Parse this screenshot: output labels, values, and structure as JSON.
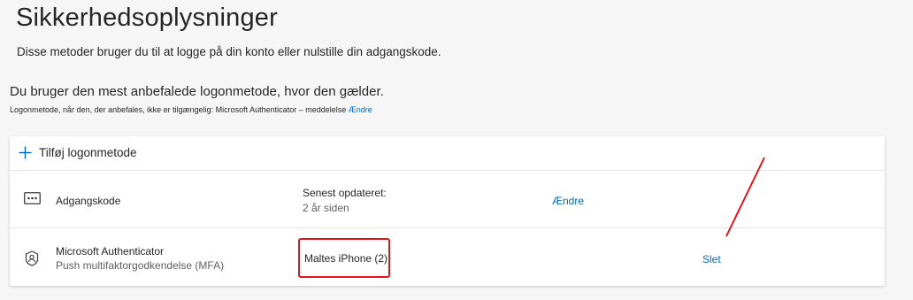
{
  "header": {
    "title": "Sikkerhedsoplysninger",
    "subtitle": "Disse metoder bruger du til at logge på din konto eller nulstille din adgangskode."
  },
  "recommendation": {
    "text": "Du bruger den mest anbefalede logonmetode, hvor den gælder.",
    "fallback_text": "Logonmetode, når den, der anbefales, ikke er tilgængelig: Microsoft Authenticator – meddelelse",
    "fallback_change_link": "Ændre"
  },
  "add_method": {
    "label": "Tilføj logonmetode",
    "icon": "plus-icon"
  },
  "methods": [
    {
      "icon": "password-dots-icon",
      "name": "Adgangskode",
      "detail_label": "Senest opdateret:",
      "detail_value": "2 år siden",
      "action": "Ændre"
    },
    {
      "icon": "authenticator-icon",
      "name": "Microsoft Authenticator",
      "description": "Push multifaktorgodkendelse (MFA)",
      "device": "Maltes iPhone (2)",
      "action": "Slet"
    }
  ],
  "colors": {
    "link": "#0067b8",
    "annotation": "#e0141a",
    "background": "#f6f6f6"
  }
}
